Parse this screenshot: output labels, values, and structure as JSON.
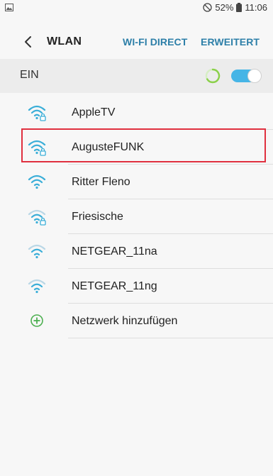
{
  "status_bar": {
    "battery": "52%",
    "time": "11:06"
  },
  "header": {
    "title": "WLAN",
    "action_wifi_direct": "WI-FI DIRECT",
    "action_advanced": "ERWEITERT"
  },
  "wlan_toggle": {
    "label": "EIN",
    "state": "on"
  },
  "networks": [
    {
      "name": "AppleTV",
      "secured": true,
      "strength": "full",
      "selected": false
    },
    {
      "name": "AugusteFUNK",
      "secured": true,
      "strength": "full",
      "selected": true
    },
    {
      "name": "Ritter Fleno",
      "secured": false,
      "strength": "full",
      "selected": false
    },
    {
      "name": "Friesische",
      "secured": true,
      "strength": "weak",
      "selected": false
    },
    {
      "name": "NETGEAR_11na",
      "secured": false,
      "strength": "weak",
      "selected": false
    },
    {
      "name": "NETGEAR_11ng",
      "secured": false,
      "strength": "weak",
      "selected": false
    }
  ],
  "add_network": {
    "label": "Netzwerk hinzufügen"
  },
  "colors": {
    "accent": "#46b5e6",
    "wifi_strong": "#3aaed8",
    "wifi_weak": "#b9d7e6",
    "add_green": "#4caf50",
    "highlight": "#e0303f"
  }
}
